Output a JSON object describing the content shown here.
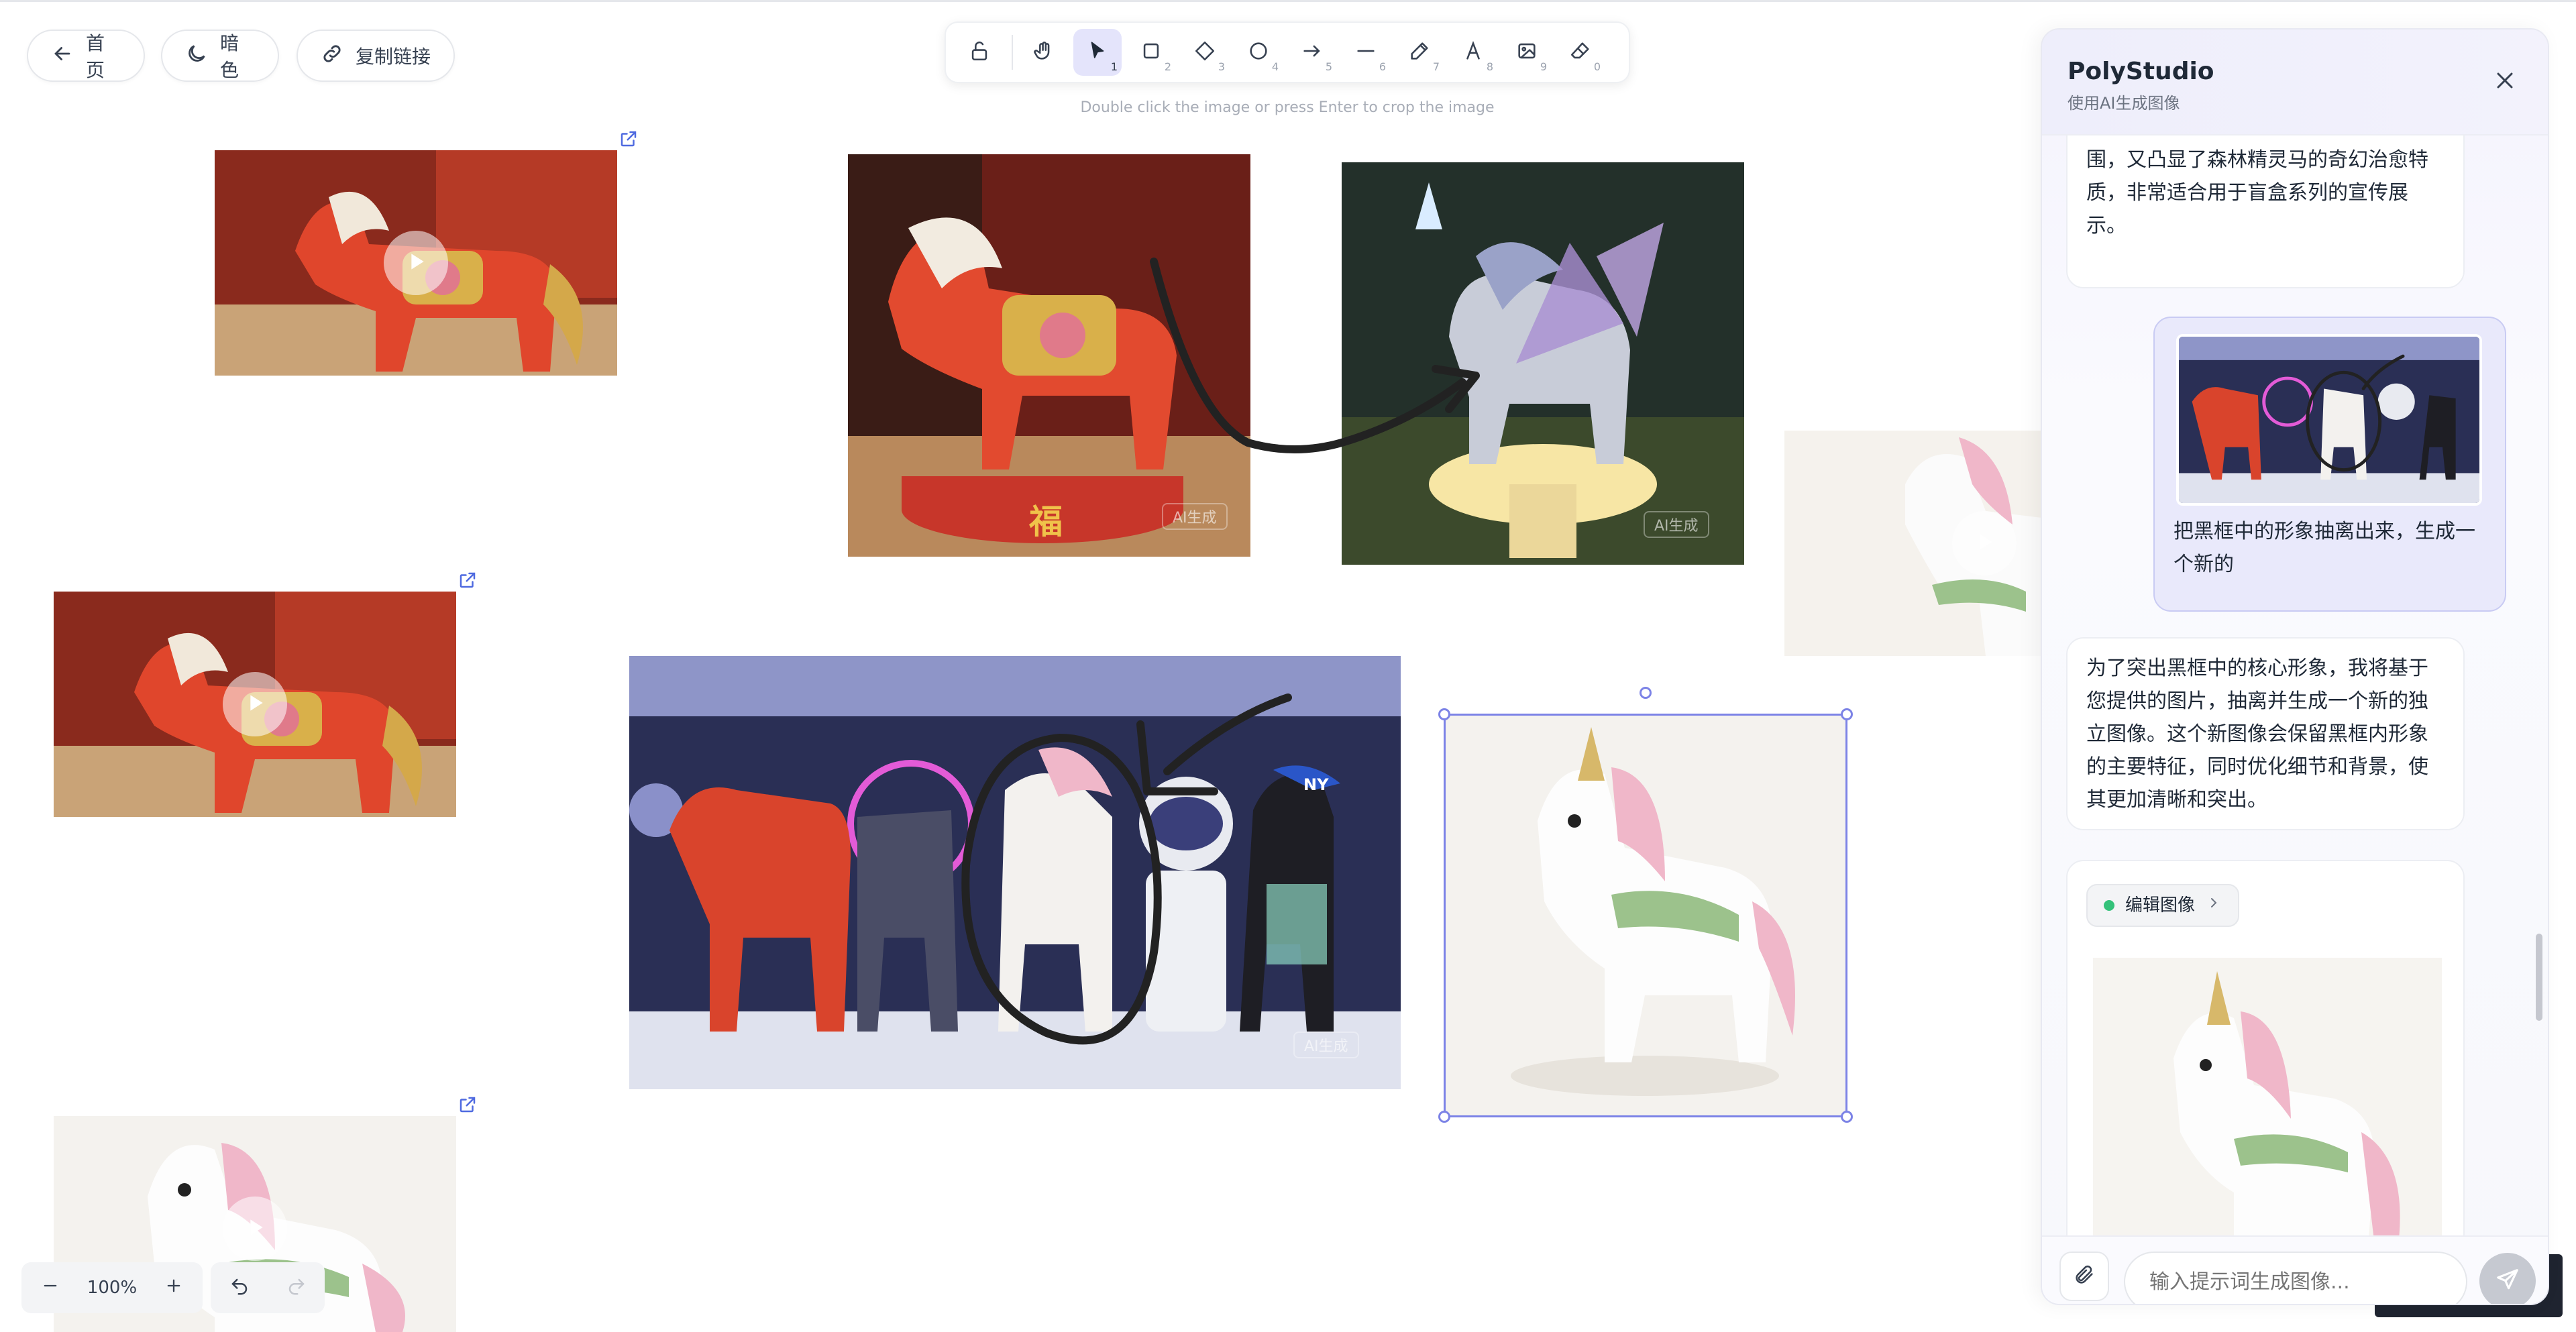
{
  "nav": {
    "home_label": "首页",
    "theme_label": "暗色",
    "copy_link_label": "复制链接"
  },
  "toolbar": {
    "tools": [
      {
        "name": "lock",
        "number": ""
      },
      {
        "name": "hand",
        "number": ""
      },
      {
        "name": "select",
        "number": "1"
      },
      {
        "name": "rectangle",
        "number": "2"
      },
      {
        "name": "diamond",
        "number": "3"
      },
      {
        "name": "ellipse",
        "number": "4"
      },
      {
        "name": "arrow",
        "number": "5"
      },
      {
        "name": "line",
        "number": "6"
      },
      {
        "name": "pencil",
        "number": "7"
      },
      {
        "name": "text",
        "number": "8"
      },
      {
        "name": "image",
        "number": "9"
      },
      {
        "name": "eraser",
        "number": "0"
      }
    ],
    "active_tool": "select",
    "hint": "Double click the image or press Enter to crop the image"
  },
  "canvas": {
    "watermark": "AI生成",
    "red_horse_base_char": "福",
    "cap_letters": "NY",
    "selection_color": "#7c83e6"
  },
  "zoom": {
    "level": "100%"
  },
  "panel": {
    "title": "PolyStudio",
    "subtitle": "使用AI生成图像",
    "messages": [
      {
        "role": "assistant",
        "lines": [
          "围，又凸显了森林精灵马的奇幻治愈特",
          "质，非常适合用于盲盒系列的宣传展",
          "示。"
        ]
      },
      {
        "role": "user",
        "lines": [
          "把黑框中的形象抽离出来，生成一",
          "个新的"
        ]
      },
      {
        "role": "assistant",
        "lines": [
          "为了突出黑框中的核心形象，我将基于",
          "您提供的图片，抽离并生成一个新的独",
          "立图像。这个新图像会保留黑框内形象",
          "的主要特征，同时优化细节和背景，使",
          "其更加清晰和突出。"
        ]
      }
    ],
    "tool_chip_label": "编辑图像",
    "input_placeholder": "输入提示词生成图像..."
  },
  "colors": {
    "accent": "#7c83e6",
    "active_tool_bg": "#e4e4fb",
    "status_dot": "#34c27a"
  }
}
